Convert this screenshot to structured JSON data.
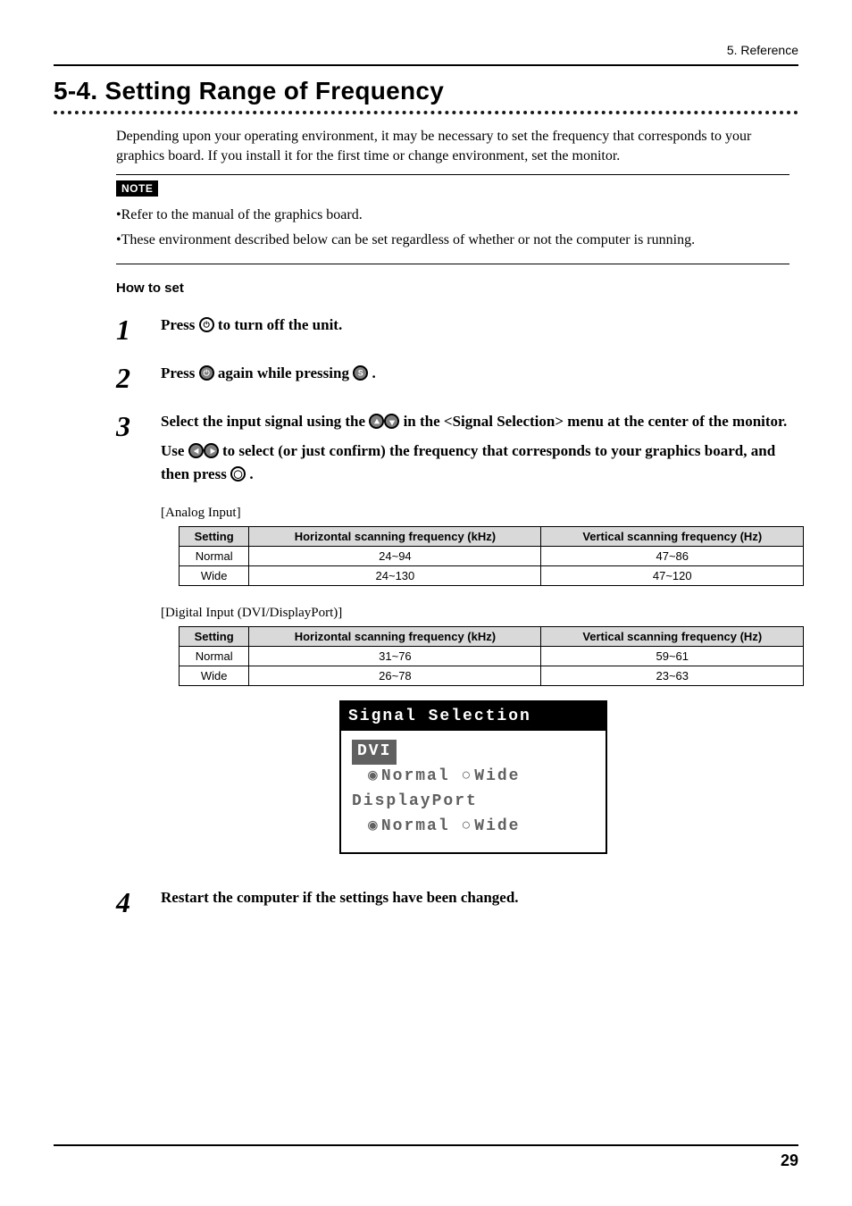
{
  "header": {
    "ref": "5. Reference"
  },
  "title": "5-4. Setting Range of Frequency",
  "intro": "Depending upon your operating environment, it may be necessary to set the frequency that corresponds to your graphics board. If you install it for the first time or change environment, set the monitor.",
  "noteLabel": "NOTE",
  "notes": [
    "Refer to the manual of the graphics board.",
    "These environment described below can be set regardless of whether or not the computer is running."
  ],
  "howToSet": "How to set",
  "steps": {
    "s1": {
      "no": "1",
      "a": "Press ",
      "b": " to turn off the unit."
    },
    "s2": {
      "no": "2",
      "a": "Press ",
      "b": " again while pressing ",
      "c": "."
    },
    "s3": {
      "no": "3",
      "a": "Select the input signal using the ",
      "b": " in the <Signal Selection> menu at the center of the monitor.",
      "c": "Use ",
      "d": " to select (or just confirm) the frequency that corresponds to your graphics board, and then press ",
      "e": "."
    },
    "s4": {
      "no": "4",
      "text": "Restart the computer if the settings have been changed."
    }
  },
  "captions": {
    "analog": "[Analog Input]",
    "digital": "[Digital Input (DVI/DisplayPort)]"
  },
  "tableHeaders": {
    "setting": "Setting",
    "h": "Horizontal scanning frequency (kHz)",
    "v": "Vertical scanning frequency (Hz)"
  },
  "chart_data": [
    {
      "type": "table",
      "title": "[Analog Input]",
      "columns": [
        "Setting",
        "Horizontal scanning frequency (kHz)",
        "Vertical scanning frequency (Hz)"
      ],
      "rows": [
        {
          "setting": "Normal",
          "h": "24~94",
          "v": "47~86"
        },
        {
          "setting": "Wide",
          "h": "24~130",
          "v": "47~120"
        }
      ]
    },
    {
      "type": "table",
      "title": "[Digital Input (DVI/DisplayPort)]",
      "columns": [
        "Setting",
        "Horizontal scanning frequency (kHz)",
        "Vertical scanning frequency (Hz)"
      ],
      "rows": [
        {
          "setting": "Normal",
          "h": "31~76",
          "v": "59~61"
        },
        {
          "setting": "Wide",
          "h": "26~78",
          "v": "23~63"
        }
      ]
    }
  ],
  "osd": {
    "title": "Signal Selection",
    "dvi": "DVI",
    "dp": "DisplayPort",
    "normal": "Normal",
    "wide": "Wide"
  },
  "pageNumber": "29"
}
